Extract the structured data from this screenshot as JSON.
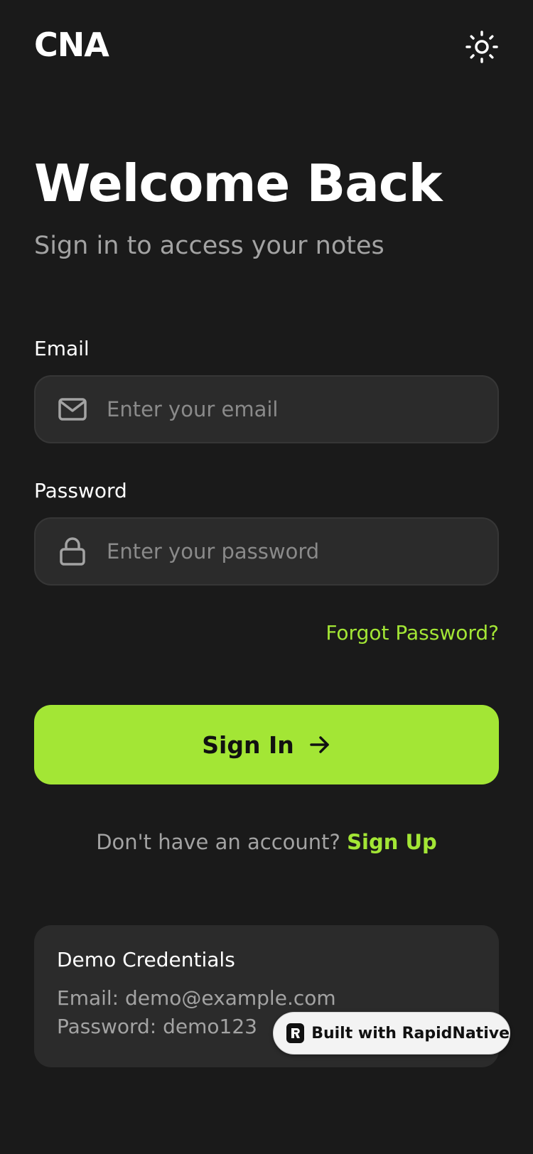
{
  "header": {
    "logo": "CNA",
    "theme_icon": "sun-icon"
  },
  "welcome": {
    "title": "Welcome Back",
    "subtitle": "Sign in to access your notes"
  },
  "form": {
    "email": {
      "label": "Email",
      "placeholder": "Enter your email",
      "value": "",
      "icon": "mail-icon"
    },
    "password": {
      "label": "Password",
      "placeholder": "Enter your password",
      "value": "",
      "icon": "lock-icon"
    },
    "forgot_label": "Forgot Password?",
    "submit_label": "Sign In",
    "submit_icon": "arrow-right-icon"
  },
  "signup": {
    "prompt": "Don't have an account?",
    "link": "Sign Up"
  },
  "demo": {
    "title": "Demo Credentials",
    "email_line": "Email: demo@example.com",
    "password_line": "Password: demo123"
  },
  "badge": {
    "label": "Built with RapidNative"
  },
  "colors": {
    "background": "#1a1a1a",
    "accent": "#a3e635",
    "field": "#2b2b2b",
    "muted": "#a3a3a3"
  }
}
